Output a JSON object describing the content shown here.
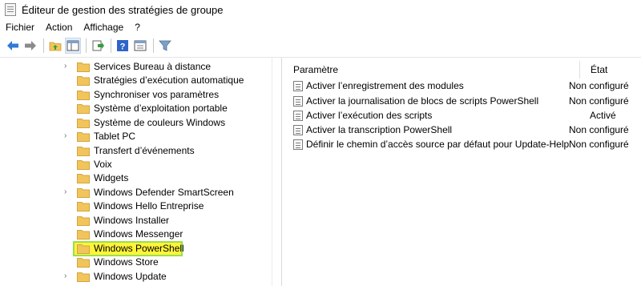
{
  "window": {
    "title": "Éditeur de gestion des stratégies de groupe"
  },
  "menu": [
    {
      "label": "Fichier"
    },
    {
      "label": "Action"
    },
    {
      "label": "Affichage"
    },
    {
      "label": "?"
    }
  ],
  "toolbar": [
    {
      "icon": "back-arrow-icon"
    },
    {
      "icon": "forward-arrow-icon"
    },
    {
      "icon": "up-folder-icon"
    },
    {
      "icon": "show-hide-tree-icon"
    },
    {
      "icon": "export-list-icon"
    },
    {
      "icon": "help-icon"
    },
    {
      "icon": "properties-icon"
    },
    {
      "icon": "filter-icon"
    }
  ],
  "tree": {
    "items": [
      {
        "label": "Services Bureau à distance",
        "expandable": true
      },
      {
        "label": "Stratégies d’exécution automatique",
        "expandable": false
      },
      {
        "label": "Synchroniser vos paramètres",
        "expandable": false
      },
      {
        "label": "Système d’exploitation portable",
        "expandable": false
      },
      {
        "label": "Système de couleurs Windows",
        "expandable": false
      },
      {
        "label": "Tablet PC",
        "expandable": true
      },
      {
        "label": "Transfert d’événements",
        "expandable": false
      },
      {
        "label": "Voix",
        "expandable": false
      },
      {
        "label": "Widgets",
        "expandable": false
      },
      {
        "label": "Windows Defender SmartScreen",
        "expandable": true
      },
      {
        "label": "Windows Hello Entreprise",
        "expandable": false
      },
      {
        "label": "Windows Installer",
        "expandable": false
      },
      {
        "label": "Windows Messenger",
        "expandable": false
      },
      {
        "label": "Windows PowerShell",
        "expandable": false,
        "selected": true
      },
      {
        "label": "Windows Store",
        "expandable": false
      },
      {
        "label": "Windows Update",
        "expandable": true
      }
    ]
  },
  "list": {
    "headers": {
      "name": "Paramètre",
      "state": "État"
    },
    "rows": [
      {
        "name": "Activer l’enregistrement des modules",
        "state": "Non configuré"
      },
      {
        "name": "Activer la journalisation de blocs de scripts PowerShell",
        "state": "Non configuré"
      },
      {
        "name": "Activer l’exécution des scripts",
        "state": "Activé"
      },
      {
        "name": "Activer la transcription PowerShell",
        "state": "Non configuré"
      },
      {
        "name": "Définir le chemin d’accès source par défaut pour Update-Help",
        "state": "Non configuré"
      }
    ]
  },
  "colors": {
    "highlight": "#fff43a",
    "highlight_border": "#9bde4f",
    "folder": "#f2c55c",
    "nav_arrow": "#2f7ad6"
  }
}
